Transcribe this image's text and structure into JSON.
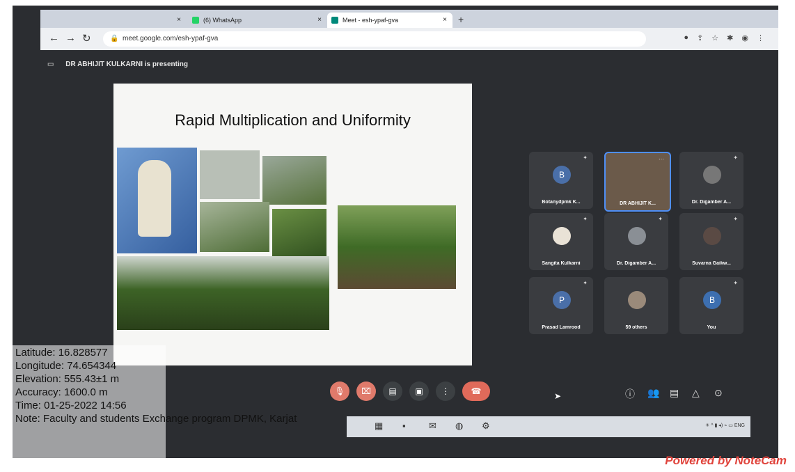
{
  "browser": {
    "tabs": [
      {
        "label": "",
        "close": "×"
      },
      {
        "label": "(6) WhatsApp",
        "close": "×"
      },
      {
        "label": "Meet - esh-ypaf-gva",
        "close": "×"
      }
    ],
    "new_tab": "+",
    "url": "meet.google.com/esh-ypaf-gva"
  },
  "meet": {
    "presenting_text": "DR ABHIJIT KULKARNI is presenting",
    "slide_title": "Rapid Multiplication and Uniformity",
    "participants": [
      {
        "name": "Botanydpmk K...",
        "initial": "B"
      },
      {
        "name": "DR ABHIJIT K...",
        "initial": ""
      },
      {
        "name": "Dr. Digamber A...",
        "initial": ""
      },
      {
        "name": "Sangita Kulkarni",
        "initial": ""
      },
      {
        "name": "Dr. Digamber A...",
        "initial": ""
      },
      {
        "name": "Suvarna Gaikw...",
        "initial": ""
      },
      {
        "name": "Prasad Lamrood",
        "initial": "P"
      },
      {
        "name": "59 others",
        "initial": ""
      },
      {
        "name": "You",
        "initial": "B"
      }
    ],
    "meeting_code": "esh-ypaf-gva"
  },
  "notecam": {
    "latitude": "Latitude: 16.828577",
    "longitude": "Longitude: 74.654344",
    "elevation": "Elevation: 555.43±1 m",
    "accuracy": "Accuracy: 1600.0 m",
    "time": "Time: 01-25-2022 14:56",
    "note": "Note: Faculty and students Exchange program DPMK, Karjat",
    "powered": "Powered by NoteCam"
  },
  "colors": {
    "accent_red": "#e0443c",
    "tile_border": "#4f8ff7"
  }
}
